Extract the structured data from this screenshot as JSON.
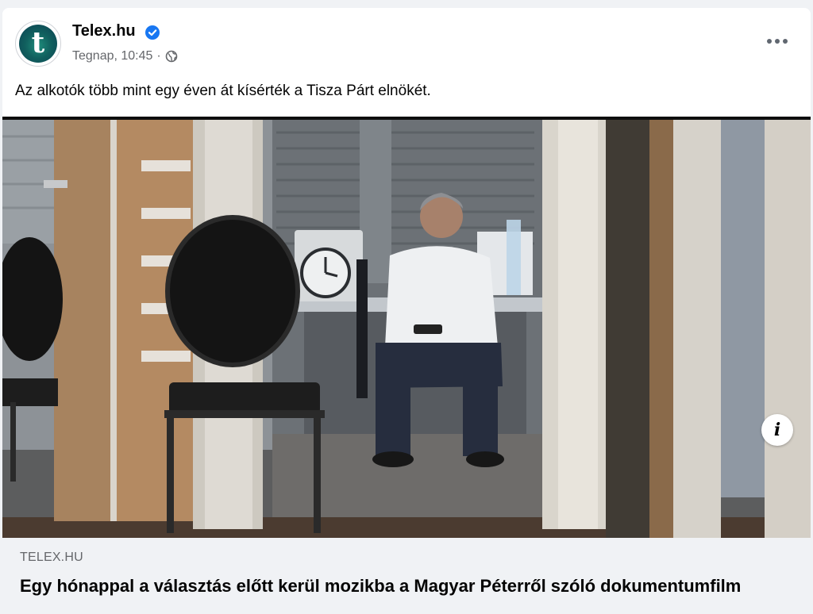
{
  "post": {
    "page_name": "Telex.hu",
    "avatar_letter": "t",
    "verified_icon": "verified-badge-icon",
    "time": "Tegnap, 10:45",
    "separator": "·",
    "audience_icon": "globe-icon",
    "text": "Az alkotók több mint egy éven át kísérték a Tisza Párt elnökét."
  },
  "link_preview": {
    "domain": "TELEX.HU",
    "title": "Egy hónappal a választás előtt kerül mozikba a Magyar Péterről szóló dokumentumfilm",
    "info_label": "i"
  },
  "colors": {
    "verified": "#1877f2",
    "secondary_text": "#65676b",
    "link_strip_bg": "#f0f2f5"
  }
}
